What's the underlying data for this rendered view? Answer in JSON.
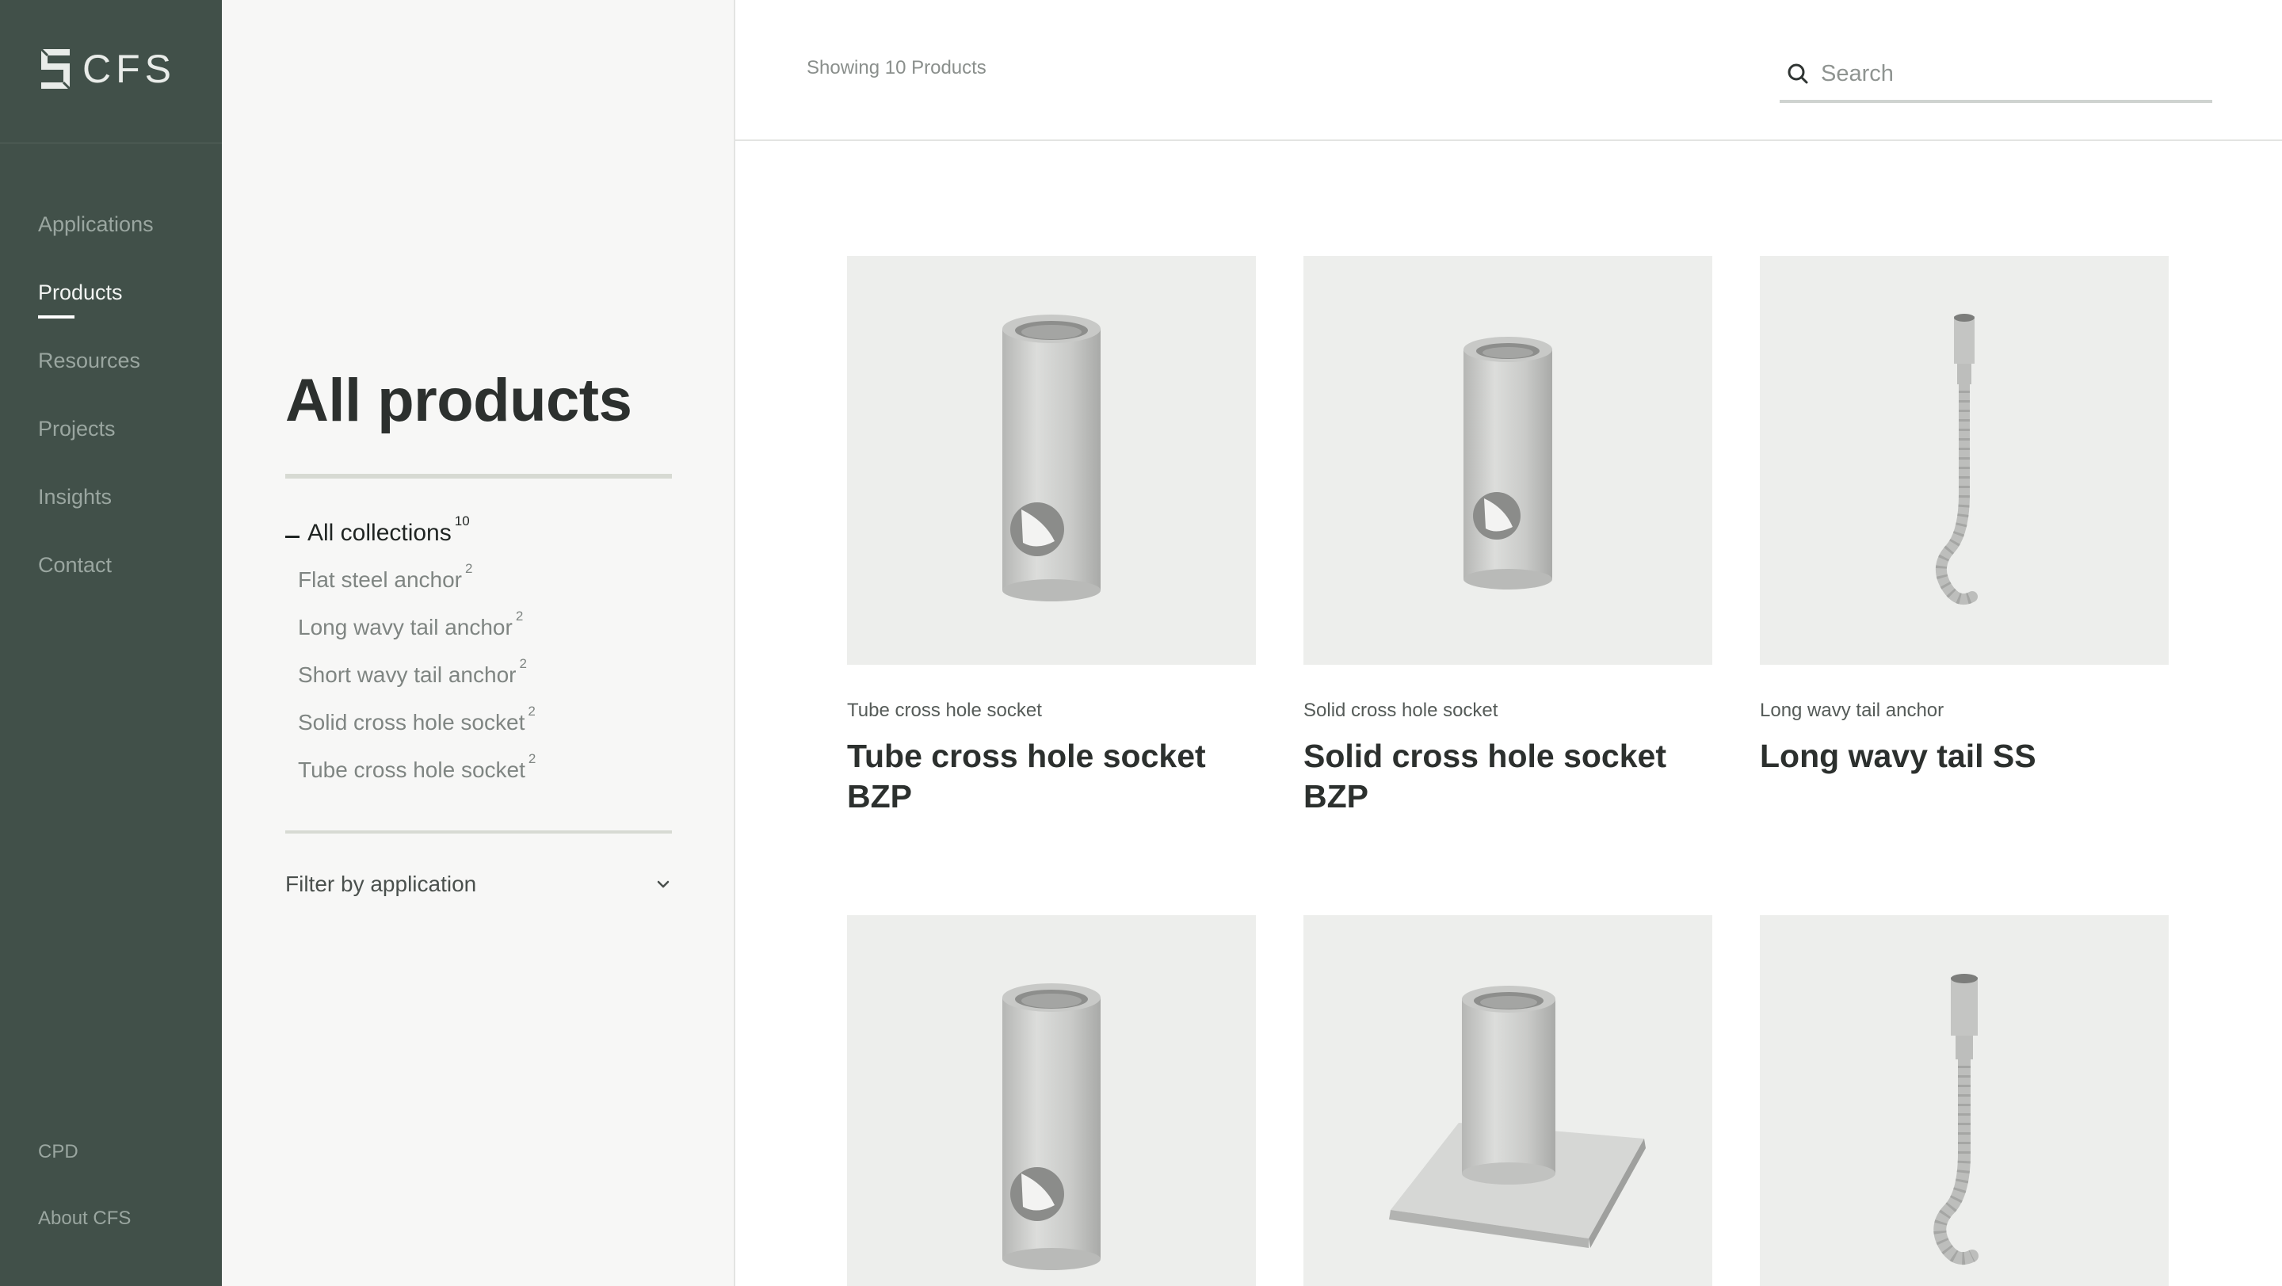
{
  "brand": {
    "name": "CFS"
  },
  "nav": {
    "items": [
      {
        "label": "Applications",
        "active": false
      },
      {
        "label": "Products",
        "active": true
      },
      {
        "label": "Resources",
        "active": false
      },
      {
        "label": "Projects",
        "active": false
      },
      {
        "label": "Insights",
        "active": false
      },
      {
        "label": "Contact",
        "active": false
      }
    ],
    "bottom": [
      {
        "label": "CPD"
      },
      {
        "label": "About CFS"
      }
    ]
  },
  "filters": {
    "title": "All products",
    "all": {
      "label": "All collections",
      "count": "10"
    },
    "collections": [
      {
        "label": "Flat steel anchor",
        "count": "2"
      },
      {
        "label": "Long wavy tail anchor",
        "count": "2"
      },
      {
        "label": "Short wavy tail anchor",
        "count": "2"
      },
      {
        "label": "Solid cross hole socket",
        "count": "2"
      },
      {
        "label": "Tube cross hole socket",
        "count": "2"
      }
    ],
    "filter_by_application": "Filter by application"
  },
  "topbar": {
    "showing": "Showing 10 Products",
    "search_placeholder": "Search"
  },
  "products": [
    {
      "category": "Tube cross hole socket",
      "title": "Tube cross hole socket BZP",
      "image": "tube-socket"
    },
    {
      "category": "Solid cross hole socket",
      "title": "Solid cross hole socket BZP",
      "image": "solid-socket"
    },
    {
      "category": "Long wavy tail anchor",
      "title": "Long wavy tail SS",
      "image": "long-wavy-tail"
    },
    {
      "category": "",
      "title": "",
      "image": "tube-socket"
    },
    {
      "category": "",
      "title": "",
      "image": "flat-plate-socket"
    },
    {
      "category": "",
      "title": "",
      "image": "short-wavy-tail"
    }
  ],
  "colors": {
    "sidebar": "#415049",
    "panel": "#f7f7f6",
    "card_bg": "#edeeec"
  }
}
